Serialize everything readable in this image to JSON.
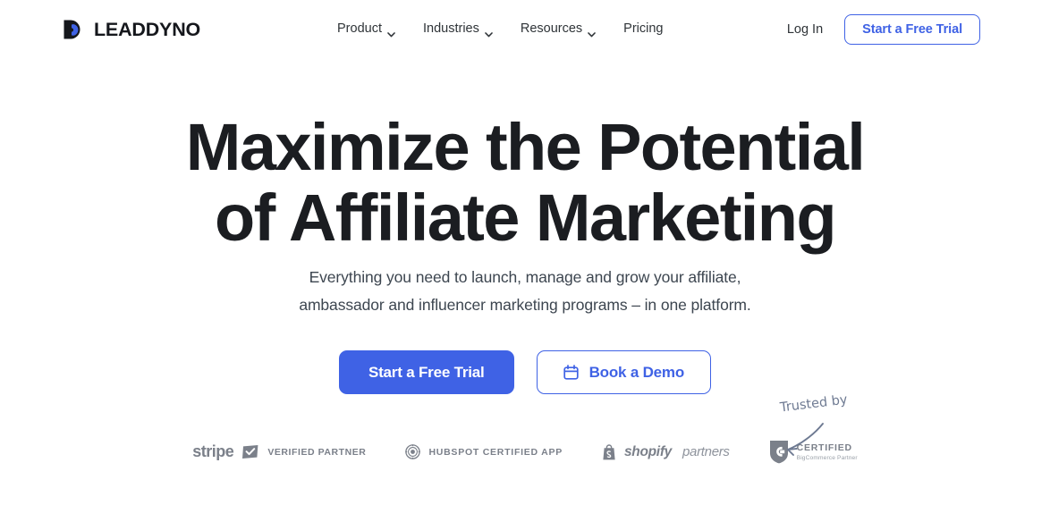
{
  "brand": {
    "name": "LEADDYNO",
    "mark_icon": "leaddyno-d-logo-icon",
    "mark_color_dark": "#15171c",
    "mark_color_blue": "#3f62e5"
  },
  "nav": {
    "items": [
      {
        "label": "Product",
        "has_caret": true,
        "caret_icon": "chevron-down-icon"
      },
      {
        "label": "Industries",
        "has_caret": true,
        "caret_icon": "chevron-down-icon"
      },
      {
        "label": "Resources",
        "has_caret": true,
        "caret_icon": "chevron-down-icon"
      },
      {
        "label": "Pricing",
        "has_caret": false,
        "caret_icon": ""
      }
    ],
    "login_label": "Log In",
    "trial_label": "Start a Free Trial"
  },
  "hero": {
    "title_line1": "Maximize the Potential",
    "title_line2": "of Affiliate Marketing",
    "sub_line1": "Everything you need to launch, manage and grow your affiliate,",
    "sub_line2": "ambassador and influencer marketing programs – in one platform.",
    "primary_cta": "Start a Free Trial",
    "secondary_cta": "Book a Demo",
    "secondary_cta_icon": "calendar-icon"
  },
  "partners": {
    "stripe": {
      "word": "stripe",
      "badge_icon": "check-badge-icon",
      "text": "VERIFIED PARTNER"
    },
    "hubspot": {
      "icon": "hubspot-sprocket-icon",
      "text": "HUBSPOT CERTIFIED APP"
    },
    "shopify": {
      "icon": "shopify-bag-icon",
      "word": "shopify",
      "suffix": "partners"
    },
    "bigcommerce": {
      "icon": "bigcommerce-shield-icon",
      "line1": "CERTIFIED",
      "line2": "BigCommerce Partner"
    }
  },
  "annotation": {
    "text": "Trusted by",
    "arrow_icon": "curved-arrow-down-left-icon",
    "color": "#6e7a92"
  },
  "theme": {
    "accent": "#3f62e5",
    "heading": "#1b1d21",
    "body_text": "#3d4650",
    "nav_text": "#2f3438",
    "muted": "#7b808a",
    "background": "#ffffff"
  }
}
